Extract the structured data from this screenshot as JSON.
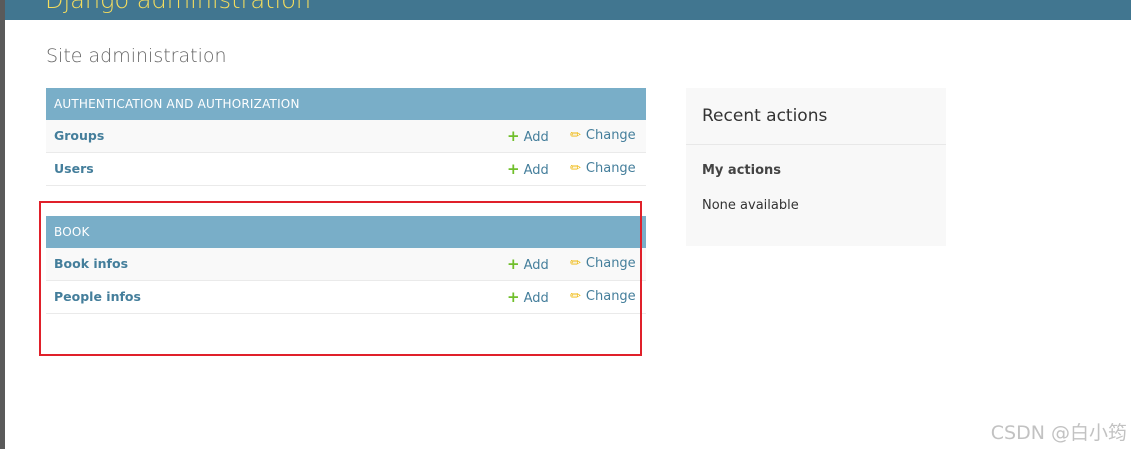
{
  "header": {
    "brand": "Django administration"
  },
  "page": {
    "title": "Site administration"
  },
  "modules": [
    {
      "name": "AUTHENTICATION AND AUTHORIZATION",
      "models": [
        {
          "name": "Groups",
          "add_label": "Add",
          "change_label": "Change"
        },
        {
          "name": "Users",
          "add_label": "Add",
          "change_label": "Change"
        }
      ]
    },
    {
      "name": "BOOK",
      "models": [
        {
          "name": "Book infos",
          "add_label": "Add",
          "change_label": "Change"
        },
        {
          "name": "People infos",
          "add_label": "Add",
          "change_label": "Change"
        }
      ]
    }
  ],
  "recent_actions": {
    "title": "Recent actions",
    "subtitle": "My actions",
    "empty_text": "None available"
  },
  "watermark": {
    "text": "CSDN @白小筠"
  },
  "colors": {
    "header_bg": "#417690",
    "brand_text": "#f5dd5d",
    "module_header_bg": "#79aec8",
    "link": "#447e9b",
    "add_icon": "#70bf2b",
    "change_icon": "#efb80b",
    "highlight": "#e0202a"
  },
  "icons": {
    "add": "plus-icon",
    "change": "pencil-icon"
  }
}
